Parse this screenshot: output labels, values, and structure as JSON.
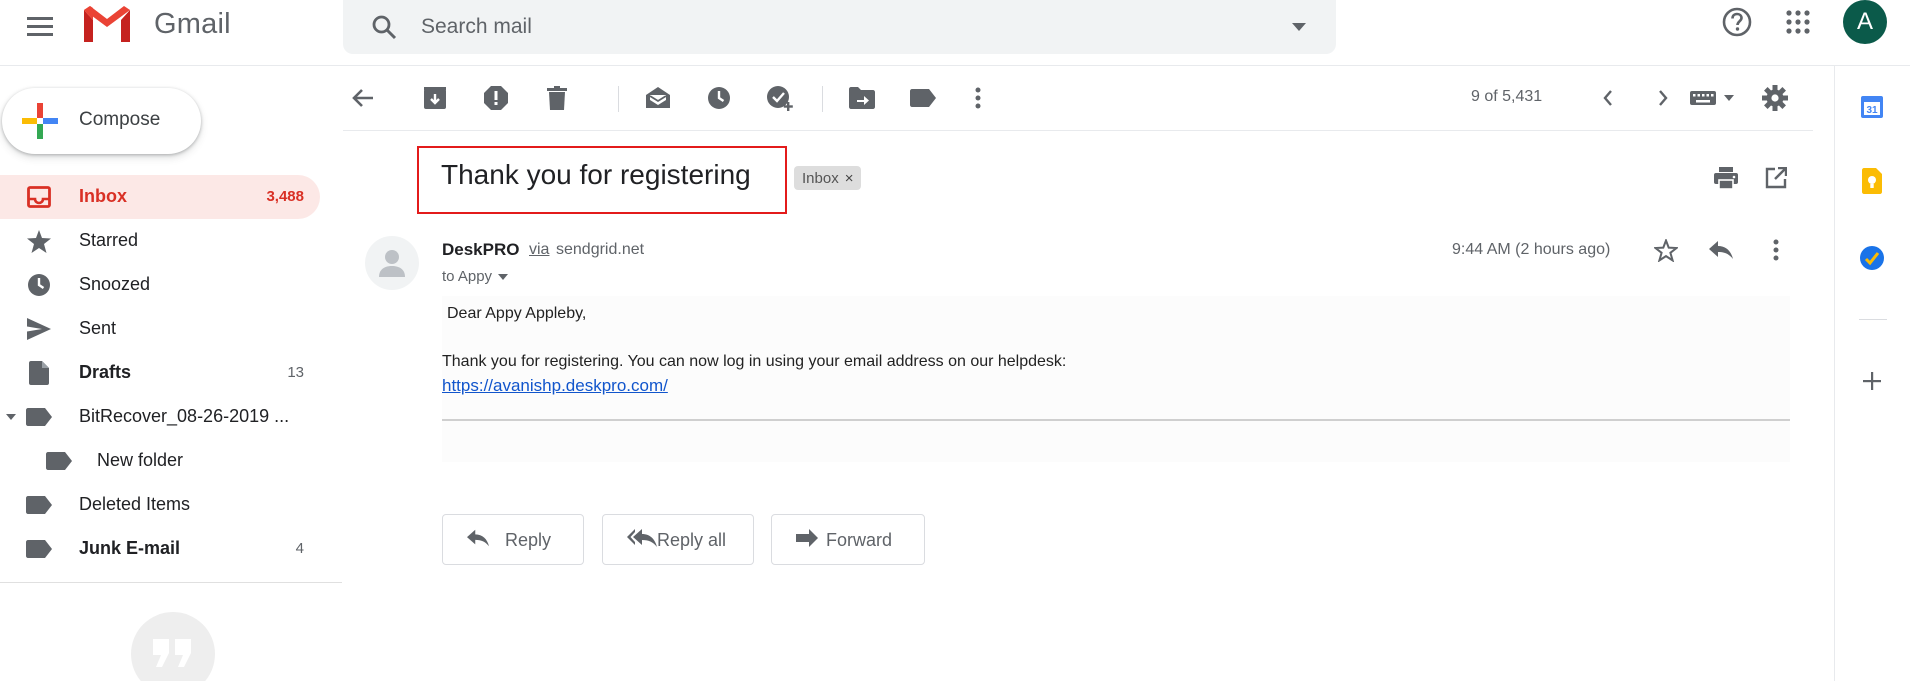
{
  "app": {
    "name": "Gmail"
  },
  "search": {
    "placeholder": "Search mail"
  },
  "account": {
    "initial": "A"
  },
  "sidebar": {
    "compose_label": "Compose",
    "items": [
      {
        "label": "Inbox",
        "count": "3,488"
      },
      {
        "label": "Starred",
        "count": ""
      },
      {
        "label": "Snoozed",
        "count": ""
      },
      {
        "label": "Sent",
        "count": ""
      },
      {
        "label": "Drafts",
        "count": "13"
      },
      {
        "label": "BitRecover_08-26-2019 ...",
        "count": ""
      },
      {
        "label": "New folder",
        "count": ""
      },
      {
        "label": "Deleted Items",
        "count": ""
      },
      {
        "label": "Junk E-mail",
        "count": "4"
      }
    ]
  },
  "toolbar": {
    "page_count": "9 of 5,431"
  },
  "message": {
    "subject": "Thank you for registering",
    "label_chip": "Inbox",
    "chip_close": "×",
    "sender_name": "DeskPRO",
    "via": "via",
    "sender_domain": "sendgrid.net",
    "to": "to Appy",
    "time": "9:44 AM (2 hours ago)",
    "greeting": "Dear Appy Appleby,",
    "body": "Thank you for registering. You can now log in using your email address on our helpdesk:",
    "link": "https://avanishp.deskpro.com/"
  },
  "actions": {
    "reply": "Reply",
    "reply_all": "Reply all",
    "forward": "Forward"
  },
  "side_panel": {
    "calendar_day": "31"
  },
  "colors": {
    "accent_red": "#d93025",
    "active_bg": "#fce8e6",
    "highlight_box": "#e31b1b",
    "avatar_bg": "#0b5a4a"
  }
}
